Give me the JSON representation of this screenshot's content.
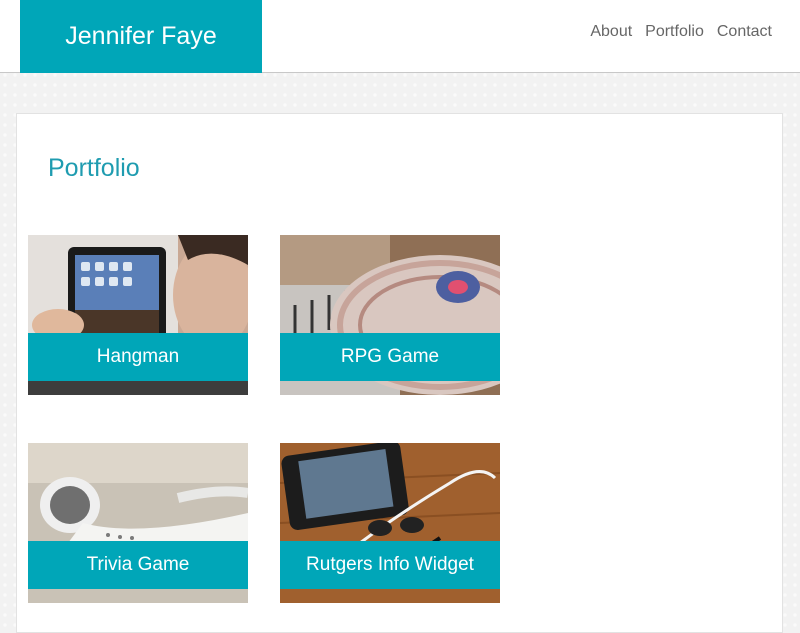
{
  "header": {
    "brand": "Jennifer Faye",
    "nav": [
      "About",
      "Portfolio",
      "Contact"
    ]
  },
  "main": {
    "title": "Portfolio",
    "items": [
      {
        "label": "Hangman",
        "image": "person-holding-tablet"
      },
      {
        "label": "RPG Game",
        "image": "dj-turntable"
      },
      {
        "label": "Trivia Game",
        "image": "earbuds"
      },
      {
        "label": "Rutgers Info Widget",
        "image": "phone-with-earphones"
      }
    ]
  },
  "colors": {
    "accent": "#00a6b8",
    "title": "#1f9cb0",
    "nav_text": "#666666"
  }
}
